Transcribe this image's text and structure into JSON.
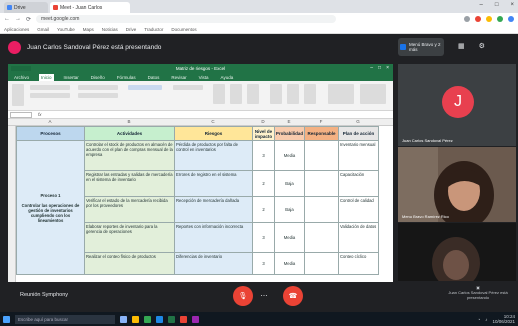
{
  "browser": {
    "tabs": [
      {
        "label": "Drive",
        "color": "#4285f4"
      },
      {
        "label": "Meet - Juan Carlos",
        "color": "#ea4335"
      }
    ],
    "url": "meet.google.com",
    "bookmarks": [
      "Aplicaciones",
      "Gmail",
      "YouTube",
      "Maps",
      "Noticias",
      "Drive",
      "Traductor",
      "Documentos"
    ]
  },
  "meet": {
    "presenter_initial": "J",
    "present_title": "Juan Carlos Sandoval Pérez está presentando",
    "presenting_chip": "Menú Bravo y 2 más",
    "meeting_name": "Reunión Symphony",
    "footer_right": "Juan Carlos Sandoval Pérez está presentando",
    "tiles": [
      {
        "initial": "J",
        "name": "Juan Carlos Sandoval Pérez"
      },
      {
        "name": "Menu Bravo Ramírez Rico"
      },
      {
        "name": ""
      }
    ]
  },
  "excel": {
    "title": "Matriz de riesgos - Excel",
    "tabs": [
      "Archivo",
      "Inicio",
      "Insertar",
      "Diseño",
      "Fórmulas",
      "Datos",
      "Revisar",
      "Vista",
      "Ayuda"
    ],
    "columns": [
      "A",
      "B",
      "C",
      "D",
      "E",
      "F",
      "G"
    ],
    "headers": [
      "Procesos",
      "Actividades",
      "Riesgos",
      "Nivel de impacto",
      "Probabilidad",
      "Responsable",
      "Plan de acción"
    ],
    "process_label": "Proceso 1",
    "process_desc": "Controlar las operaciones de gestión de inventarios cumpliendo con los lineamientos",
    "rows": [
      {
        "act": "Controlar el stock de productos en almacén de acuerdo con el plan de compras mensual de la empresa",
        "risk": "Pérdida de productos por falta de control en inventarios",
        "imp": "3",
        "prob": "Media",
        "plan": "Inventario mensual"
      },
      {
        "act": "Registrar las entradas y salidas de mercadería en el sistema de inventario",
        "risk": "Errores de registro en el sistema",
        "imp": "2",
        "prob": "Baja",
        "plan": "Capacitación"
      },
      {
        "act": "Verificar el estado de la mercadería recibida por los proveedores",
        "risk": "Recepción de mercadería dañada",
        "imp": "2",
        "prob": "Baja",
        "plan": "Control de calidad"
      },
      {
        "act": "Elaborar reportes de inventario para la gerencia de operaciones",
        "risk": "Reportes con información incorrecta",
        "imp": "3",
        "prob": "Media",
        "plan": "Validación de datos"
      },
      {
        "act": "Realizar el conteo físico de productos",
        "risk": "Diferencias de inventario",
        "imp": "3",
        "prob": "Media",
        "plan": "Conteo cíclico"
      }
    ]
  },
  "taskbar": {
    "search": "Escribe aquí para buscar",
    "time": "10:24",
    "date": "10/06/2021"
  }
}
